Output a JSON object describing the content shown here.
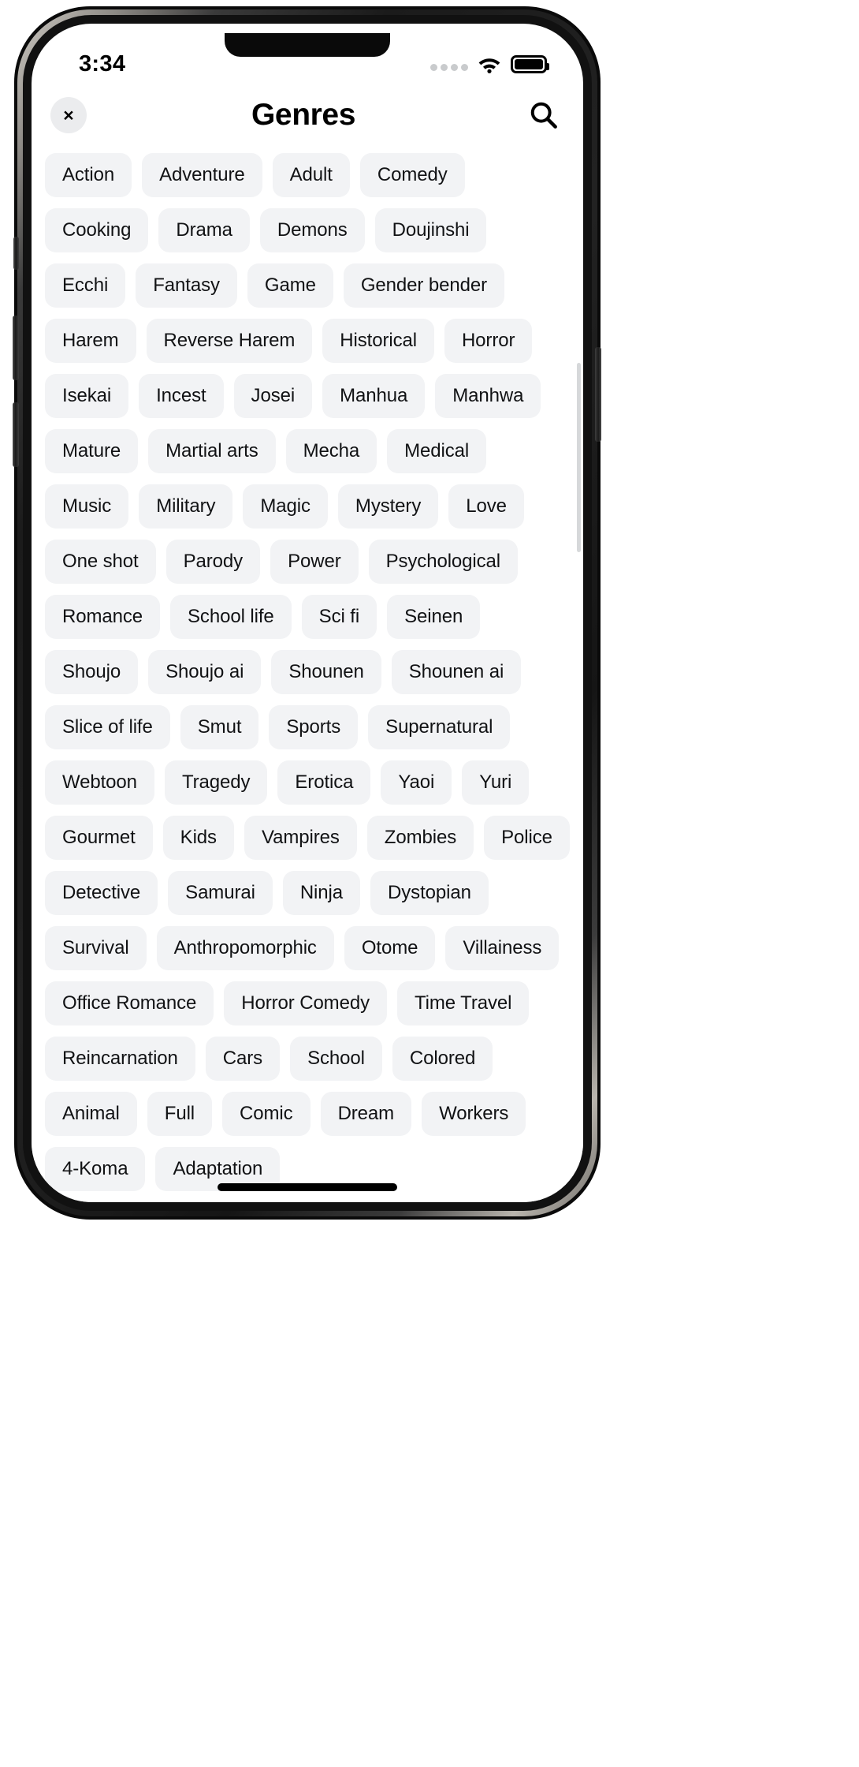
{
  "status_bar": {
    "time": "3:34",
    "signal_icon": "signal-dots-icon",
    "wifi_icon": "wifi-icon",
    "battery_icon": "battery-icon",
    "battery_level_percent": 100
  },
  "header": {
    "close_label": "×",
    "title": "Genres",
    "search_icon": "search-icon"
  },
  "genres": [
    "Action",
    "Adventure",
    "Adult",
    "Comedy",
    "Cooking",
    "Drama",
    "Demons",
    "Doujinshi",
    "Ecchi",
    "Fantasy",
    "Game",
    "Gender bender",
    "Harem",
    "Reverse Harem",
    "Historical",
    "Horror",
    "Isekai",
    "Incest",
    "Josei",
    "Manhua",
    "Manhwa",
    "Mature",
    "Martial arts",
    "Mecha",
    "Medical",
    "Music",
    "Military",
    "Magic",
    "Mystery",
    "Love",
    "One shot",
    "Parody",
    "Power",
    "Psychological",
    "Romance",
    "School life",
    "Sci fi",
    "Seinen",
    "Shoujo",
    "Shoujo ai",
    "Shounen",
    "Shounen ai",
    "Slice of life",
    "Smut",
    "Sports",
    "Supernatural",
    "Webtoon",
    "Tragedy",
    "Erotica",
    "Yaoi",
    "Yuri",
    "Gourmet",
    "Kids",
    "Vampires",
    "Zombies",
    "Police",
    "Detective",
    "Samurai",
    "Ninja",
    "Dystopian",
    "Survival",
    "Anthropomorphic",
    "Otome",
    "Villainess",
    "Office Romance",
    "Horror Comedy",
    "Time Travel",
    "Reincarnation",
    "Cars",
    "School",
    "Colored",
    "Animal",
    "Full",
    "Comic",
    "Dream",
    "Workers",
    "4-Koma",
    "Adaptation"
  ],
  "colors": {
    "chip_background": "#f2f3f5",
    "chip_text": "#111214",
    "page_background": "#ffffff",
    "close_button_background": "#ebecee",
    "signal_dot": "#c9cbcd"
  }
}
